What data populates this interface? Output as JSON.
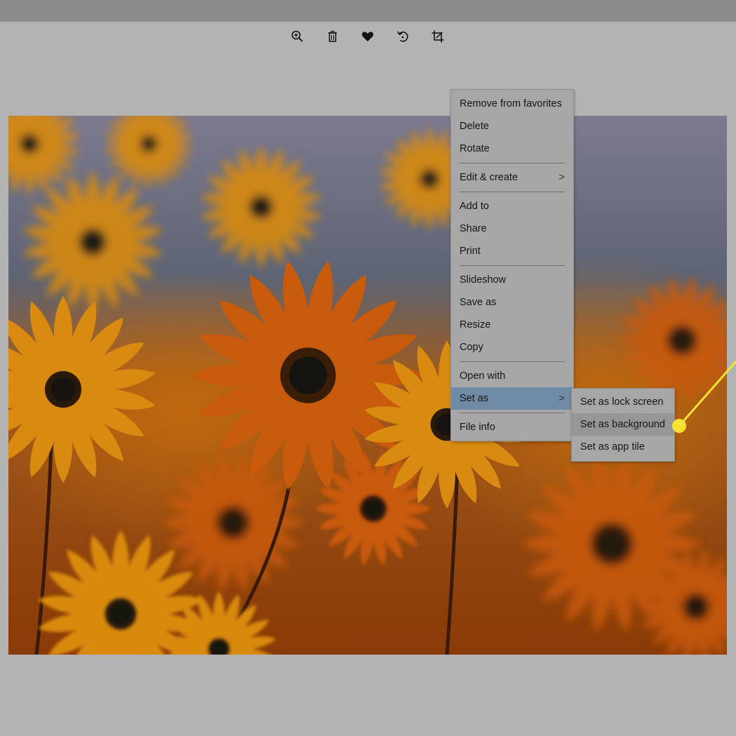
{
  "toolbar": {
    "buttons": [
      {
        "name": "zoom-in",
        "icon": "zoom-in-icon"
      },
      {
        "name": "delete",
        "icon": "trash-icon"
      },
      {
        "name": "favorite",
        "icon": "heart-icon"
      },
      {
        "name": "rotate",
        "icon": "rotate-icon"
      },
      {
        "name": "crop",
        "icon": "crop-icon"
      }
    ]
  },
  "photo": {
    "subject": "orange daisy field"
  },
  "context_menu": {
    "items": [
      {
        "label": "Remove from favorites"
      },
      {
        "label": "Delete"
      },
      {
        "label": "Rotate"
      },
      {
        "label": "Edit & create",
        "submenu": true
      },
      {
        "label": "Add to"
      },
      {
        "label": "Share"
      },
      {
        "label": "Print"
      },
      {
        "label": "Slideshow"
      },
      {
        "label": "Save as"
      },
      {
        "label": "Resize"
      },
      {
        "label": "Copy"
      },
      {
        "label": "Open with"
      },
      {
        "label": "Set as",
        "submenu": true,
        "state": "selected"
      },
      {
        "label": "File info"
      }
    ],
    "chevron_glyph": ">"
  },
  "set_as_submenu": {
    "items": [
      {
        "label": "Set as lock screen"
      },
      {
        "label": "Set as background",
        "state": "highlighted"
      },
      {
        "label": "Set as app tile"
      }
    ]
  },
  "colors": {
    "page_background": "#b3b3b3",
    "menu_background": "#a7a7a7",
    "selected_item": "#6f8ba5",
    "highlighted_item": "#969696",
    "callout_yellow": "#f5e233"
  }
}
